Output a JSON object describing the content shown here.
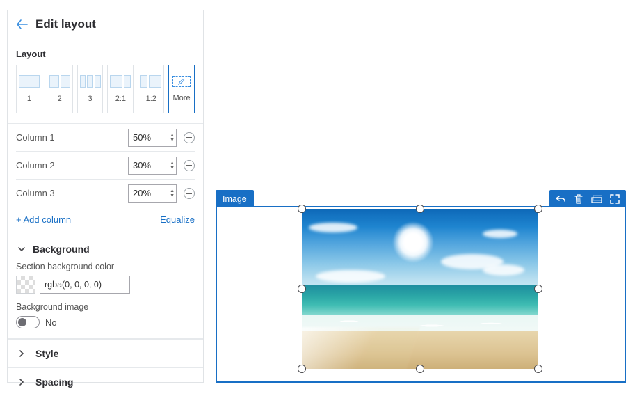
{
  "panel": {
    "title": "Edit layout",
    "layout_section_label": "Layout",
    "tiles": [
      {
        "label": "1"
      },
      {
        "label": "2"
      },
      {
        "label": "3"
      },
      {
        "label": "2:1"
      },
      {
        "label": "1:2"
      },
      {
        "label": "More"
      }
    ],
    "selected_tile": 5,
    "columns": [
      {
        "label": "Column 1",
        "value": "50%"
      },
      {
        "label": "Column 2",
        "value": "30%"
      },
      {
        "label": "Column 3",
        "value": "20%"
      }
    ],
    "add_column_label": "+ Add column",
    "equalize_label": "Equalize",
    "background": {
      "header": "Background",
      "color_label": "Section background color",
      "color_value": "rgba(0, 0, 0, 0)",
      "image_label": "Background image",
      "image_toggle_text": "No",
      "image_toggle_on": false
    },
    "style_header": "Style",
    "spacing_header": "Spacing"
  },
  "block": {
    "tag": "Image"
  },
  "icons": {
    "back": "back-arrow-icon",
    "chev_down": "chevron-down-icon",
    "chev_right": "chevron-right-icon",
    "pencil": "pencil-icon",
    "undo": "undo-icon",
    "trash": "trash-icon",
    "outline": "outline-icon",
    "expand": "expand-icon"
  }
}
